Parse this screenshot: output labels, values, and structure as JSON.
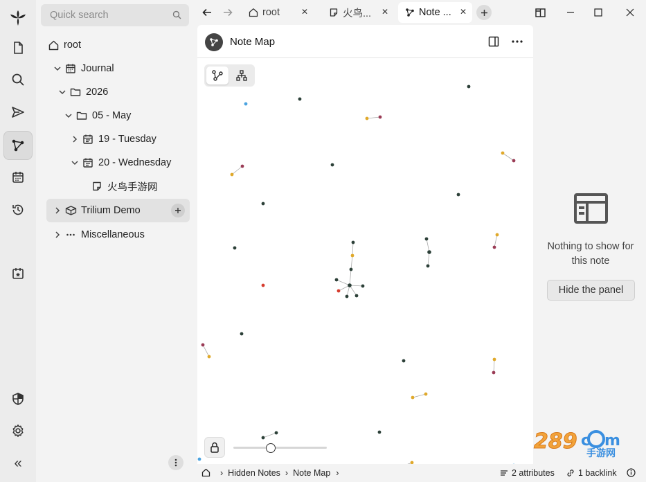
{
  "launcher": {
    "items": [
      {
        "icon": "trilium-logo-icon"
      },
      {
        "icon": "new-note-icon"
      },
      {
        "icon": "search-icon"
      },
      {
        "icon": "jump-to-note-icon"
      },
      {
        "icon": "note-map-icon",
        "active": true
      },
      {
        "icon": "calendar-icon"
      },
      {
        "icon": "recent-changes-icon"
      },
      {
        "icon": "today-note-icon"
      },
      {
        "icon": "protected-session-icon"
      },
      {
        "icon": "settings-icon"
      },
      {
        "icon": "collapse-sidebar-icon"
      }
    ]
  },
  "search": {
    "placeholder": "Quick search"
  },
  "tree": {
    "root": "root",
    "journal": "Journal",
    "year": "2026",
    "month": "05 - May",
    "day19": "19 - Tuesday",
    "day20": "20 - Wednesday",
    "note": "火鸟手游网",
    "trilium_demo": "Trilium Demo",
    "misc": "Miscellaneous"
  },
  "tabs": [
    {
      "label": "root",
      "icon": "home-icon"
    },
    {
      "label": "火鸟...",
      "icon": "note-icon"
    },
    {
      "label": "Note ...",
      "icon": "note-map-icon",
      "active": true
    }
  ],
  "note": {
    "title": "Note Map"
  },
  "right_panel": {
    "message_line1": "Nothing to show for",
    "message_line2": "this note",
    "hide_button": "Hide the panel"
  },
  "breadcrumb": {
    "items": [
      "Hidden Notes",
      "Note Map"
    ]
  },
  "status": {
    "attributes": "2 attributes",
    "backlinks": "1 backlink"
  },
  "zoom_level": 0.4,
  "watermark": "289.com 手游网",
  "colors": {
    "node_dark": "#2c4038",
    "node_gold": "#e0a92a",
    "node_maroon": "#9a3b55",
    "node_red": "#d63c2e",
    "node_blue": "#4aa3e0",
    "node_green": "#7ed957",
    "accent_active": "#dcdcdc"
  }
}
